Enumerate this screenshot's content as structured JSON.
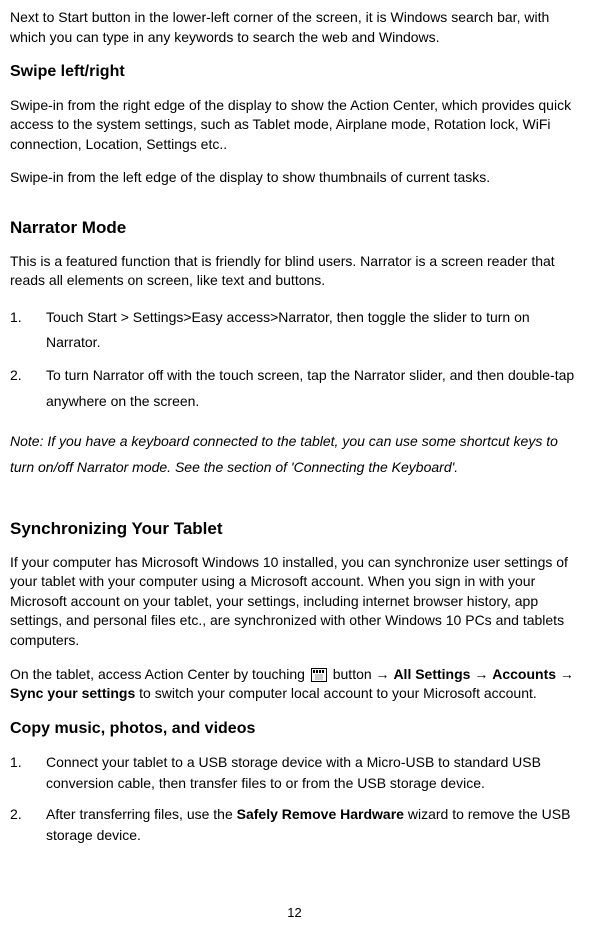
{
  "intro_paragraph": "Next to Start button in the lower-left corner of the screen, it is Windows search bar, with which you can type in any keywords to search the web and Windows.",
  "swipe": {
    "heading": "Swipe left/right",
    "p1": "Swipe-in from the right edge of the display to show the Action Center, which provides quick access to the system settings, such as Tablet mode, Airplane mode, Rotation lock, WiFi connection, Location, Settings etc..",
    "p2": "Swipe-in from the left edge of the display to show thumbnails of current tasks."
  },
  "narrator": {
    "heading": "Narrator Mode",
    "intro": "This is a featured function that is friendly for blind users. Narrator is a screen reader that reads all elements on screen, like text and buttons.",
    "steps": [
      "Touch Start > Settings>Easy access>Narrator, then toggle the slider to turn on Narrator.",
      "To turn Narrator off with the touch screen, tap the Narrator slider, and then double-tap anywhere on the screen."
    ],
    "note": "Note: If you have a keyboard connected to the tablet, you can use some shortcut keys to turn on/off Narrator mode. See the section of 'Connecting the Keyboard'."
  },
  "sync": {
    "heading": "Synchronizing Your Tablet",
    "p1": "If your computer has Microsoft Windows 10 installed, you can synchronize user settings of your tablet with your computer using a Microsoft account. When you sign in with your Microsoft account on your tablet, your settings, including internet browser history, app settings, and personal files etc., are synchronized with other Windows 10 PCs and tablets computers.",
    "p2_before": "On the tablet, access Action Center by touching ",
    "p2_after_icon": " button → ",
    "p2_bold1": "All Settings",
    "p2_mid1": " → ",
    "p2_bold2": "Accounts",
    "p2_mid2": " → ",
    "p2_bold3": "Sync your settings",
    "p2_end": " to switch your computer local account to your Microsoft account."
  },
  "copy": {
    "heading": "Copy music, photos, and videos",
    "steps": [
      "Connect your tablet to a USB storage device with a Micro-USB to standard USB conversion cable, then transfer files to or from the USB storage device.",
      {
        "before": "After transferring files, use the ",
        "bold": "Safely Remove Hardware",
        "after": " wizard to remove the USB storage device."
      }
    ]
  },
  "page_number": "12"
}
